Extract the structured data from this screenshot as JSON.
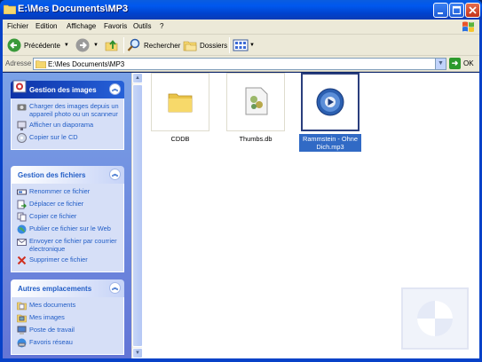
{
  "window": {
    "title": "E:\\Mes Documents\\MP3"
  },
  "menu": [
    "Fichier",
    "Edition",
    "Affichage",
    "Favoris",
    "Outils",
    "?"
  ],
  "toolbar": {
    "back_label": "Précédente",
    "search_label": "Rechercher",
    "folders_label": "Dossiers"
  },
  "address": {
    "label": "Adresse",
    "value": "E:\\Mes Documents\\MP3",
    "go_label": "OK"
  },
  "panels": {
    "images": {
      "title": "Gestion des images",
      "items": [
        "Charger des images depuis un appareil photo ou un scanneur",
        "Afficher un diaporama",
        "Copier sur le CD"
      ]
    },
    "files": {
      "title": "Gestion des fichiers",
      "items": [
        "Renommer ce fichier",
        "Déplacer ce fichier",
        "Copier ce fichier",
        "Publier ce fichier sur le Web",
        "Envoyer ce fichier par courrier électronique",
        "Supprimer ce fichier"
      ]
    },
    "places": {
      "title": "Autres emplacements",
      "items": [
        "Mes documents",
        "Mes images",
        "Poste de travail",
        "Favoris réseau"
      ]
    }
  },
  "files": [
    {
      "name": "CDDB",
      "icon": "folder-icon"
    },
    {
      "name": "Thumbs.db",
      "icon": "db-file-icon"
    },
    {
      "name": "Rammstein - Ohne Dich.mp3",
      "icon": "media-file-icon",
      "selected": true
    }
  ]
}
